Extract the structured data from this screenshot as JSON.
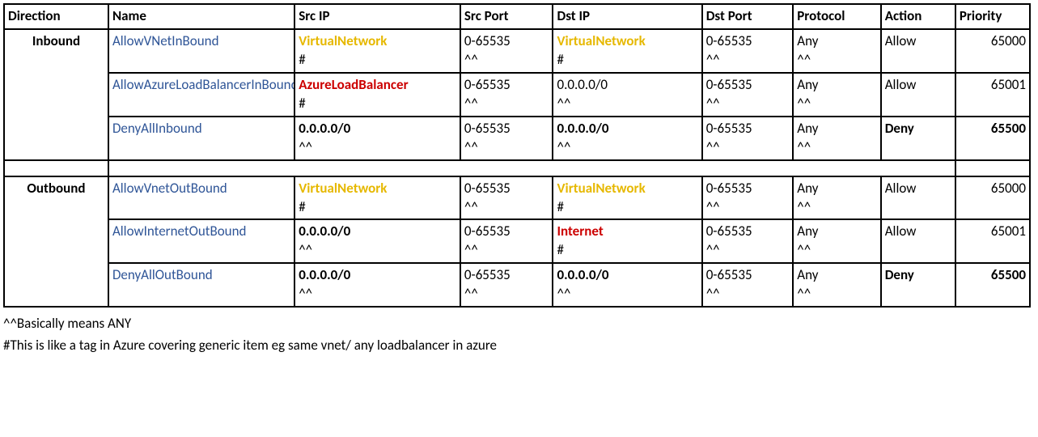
{
  "headers": {
    "direction": "Direction",
    "name": "Name",
    "srcip": "Src IP",
    "srcport": "Src Port",
    "dstip": "Dst IP",
    "dstport": "Dst Port",
    "protocol": "Protocol",
    "action": "Action",
    "priority": "Priority"
  },
  "groups": [
    {
      "direction": "Inbound",
      "rules": [
        {
          "name": "AllowVNetInBound",
          "srcip": {
            "l1": "VirtualNetwork",
            "l2": "#",
            "style": "tag-yellow"
          },
          "srcport": {
            "l1": "0-65535",
            "l2": "^^",
            "style": ""
          },
          "dstip": {
            "l1": "VirtualNetwork",
            "l2": "#",
            "style": "tag-yellow"
          },
          "dstport": {
            "l1": "0-65535",
            "l2": "^^",
            "style": ""
          },
          "protocol": {
            "l1": "Any",
            "l2": "^^",
            "style": ""
          },
          "action": "Allow",
          "action_bold": false,
          "priority": "65000",
          "priority_bold": false
        },
        {
          "name": "AllowAzureLoadBalancerInBound",
          "srcip": {
            "l1": "AzureLoadBalancer",
            "l2": "#",
            "style": "tag-red"
          },
          "srcport": {
            "l1": "0-65535",
            "l2": "^^",
            "style": ""
          },
          "dstip": {
            "l1": "0.0.0.0/0",
            "l2": "^^",
            "style": ""
          },
          "dstport": {
            "l1": "0-65535",
            "l2": "^^",
            "style": ""
          },
          "protocol": {
            "l1": "Any",
            "l2": "^^",
            "style": ""
          },
          "action": "Allow",
          "action_bold": false,
          "priority": "65001",
          "priority_bold": false
        },
        {
          "name": "DenyAllInbound",
          "srcip": {
            "l1": "0.0.0.0/0",
            "l2": "^^",
            "style": "bold"
          },
          "srcport": {
            "l1": "0-65535",
            "l2": "^^",
            "style": ""
          },
          "dstip": {
            "l1": "0.0.0.0/0",
            "l2": "^^",
            "style": "bold"
          },
          "dstport": {
            "l1": "0-65535",
            "l2": "^^",
            "style": ""
          },
          "protocol": {
            "l1": "Any",
            "l2": "^^",
            "style": ""
          },
          "action": "Deny",
          "action_bold": true,
          "priority": "65500",
          "priority_bold": true
        }
      ]
    },
    {
      "direction": "Outbound",
      "rules": [
        {
          "name": "AllowVnetOutBound",
          "srcip": {
            "l1": "VirtualNetwork",
            "l2": "#",
            "style": "tag-yellow"
          },
          "srcport": {
            "l1": "0-65535",
            "l2": "^^",
            "style": ""
          },
          "dstip": {
            "l1": "VirtualNetwork",
            "l2": "#",
            "style": "tag-yellow"
          },
          "dstport": {
            "l1": "0-65535",
            "l2": "^^",
            "style": ""
          },
          "protocol": {
            "l1": "Any",
            "l2": "^^",
            "style": ""
          },
          "action": "Allow",
          "action_bold": false,
          "priority": "65000",
          "priority_bold": false
        },
        {
          "name": "AllowInternetOutBound",
          "srcip": {
            "l1": "0.0.0.0/0",
            "l2": "^^",
            "style": "bold"
          },
          "srcport": {
            "l1": "0-65535",
            "l2": "^^",
            "style": ""
          },
          "dstip": {
            "l1": "Internet",
            "l2": "#",
            "style": "tag-red"
          },
          "dstport": {
            "l1": "0-65535",
            "l2": "^^",
            "style": ""
          },
          "protocol": {
            "l1": "Any",
            "l2": "^^",
            "style": ""
          },
          "action": "Allow",
          "action_bold": false,
          "priority": "65001",
          "priority_bold": false
        },
        {
          "name": "DenyAllOutBound",
          "srcip": {
            "l1": "0.0.0.0/0",
            "l2": "^^",
            "style": "bold"
          },
          "srcport": {
            "l1": "0-65535",
            "l2": "^^",
            "style": ""
          },
          "dstip": {
            "l1": "0.0.0.0/0",
            "l2": "^^",
            "style": "bold"
          },
          "dstport": {
            "l1": "0-65535",
            "l2": "^^",
            "style": ""
          },
          "protocol": {
            "l1": "Any",
            "l2": "^^",
            "style": ""
          },
          "action": "Deny",
          "action_bold": true,
          "priority": "65500",
          "priority_bold": true
        }
      ]
    }
  ],
  "notes": {
    "n1": "^^Basically means ANY",
    "n2": "#This is like a tag in Azure covering generic item eg same vnet/ any loadbalancer in azure"
  }
}
